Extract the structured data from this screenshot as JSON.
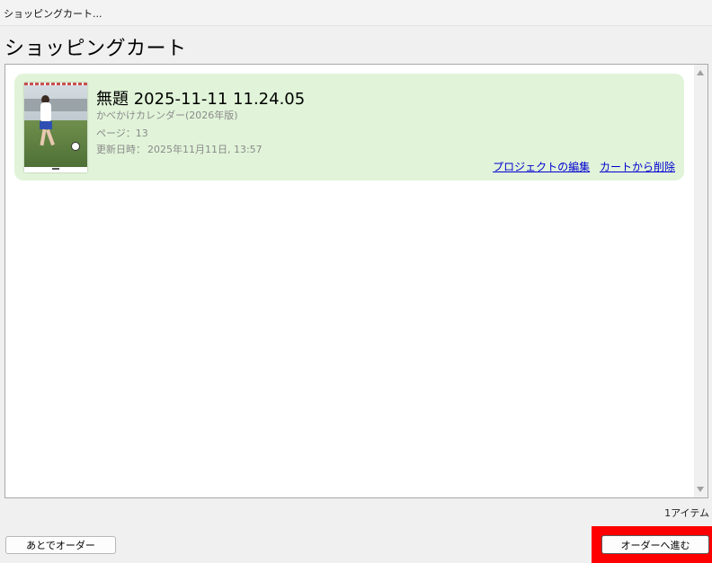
{
  "window": {
    "title": "ショッピングカート..."
  },
  "page": {
    "title": "ショッピングカート"
  },
  "cart": {
    "items": [
      {
        "title": "無題 2025-11-11 11.24.05",
        "product": "かべかけカレンダー(2026年版)",
        "pages": "ページ：13",
        "updated_label": "更新日時：",
        "updated_value": "2025年11月11日, 13:57",
        "edit_link": "プロジェクトの編集",
        "remove_link": "カートから削除"
      }
    ],
    "count": "1アイテム"
  },
  "buttons": {
    "later": "あとでオーダー",
    "proceed": "オーダーへ進む"
  },
  "colors": {
    "item_bg": "#e1f4d9",
    "link": "#0000d0",
    "highlight": "#ff0000"
  }
}
